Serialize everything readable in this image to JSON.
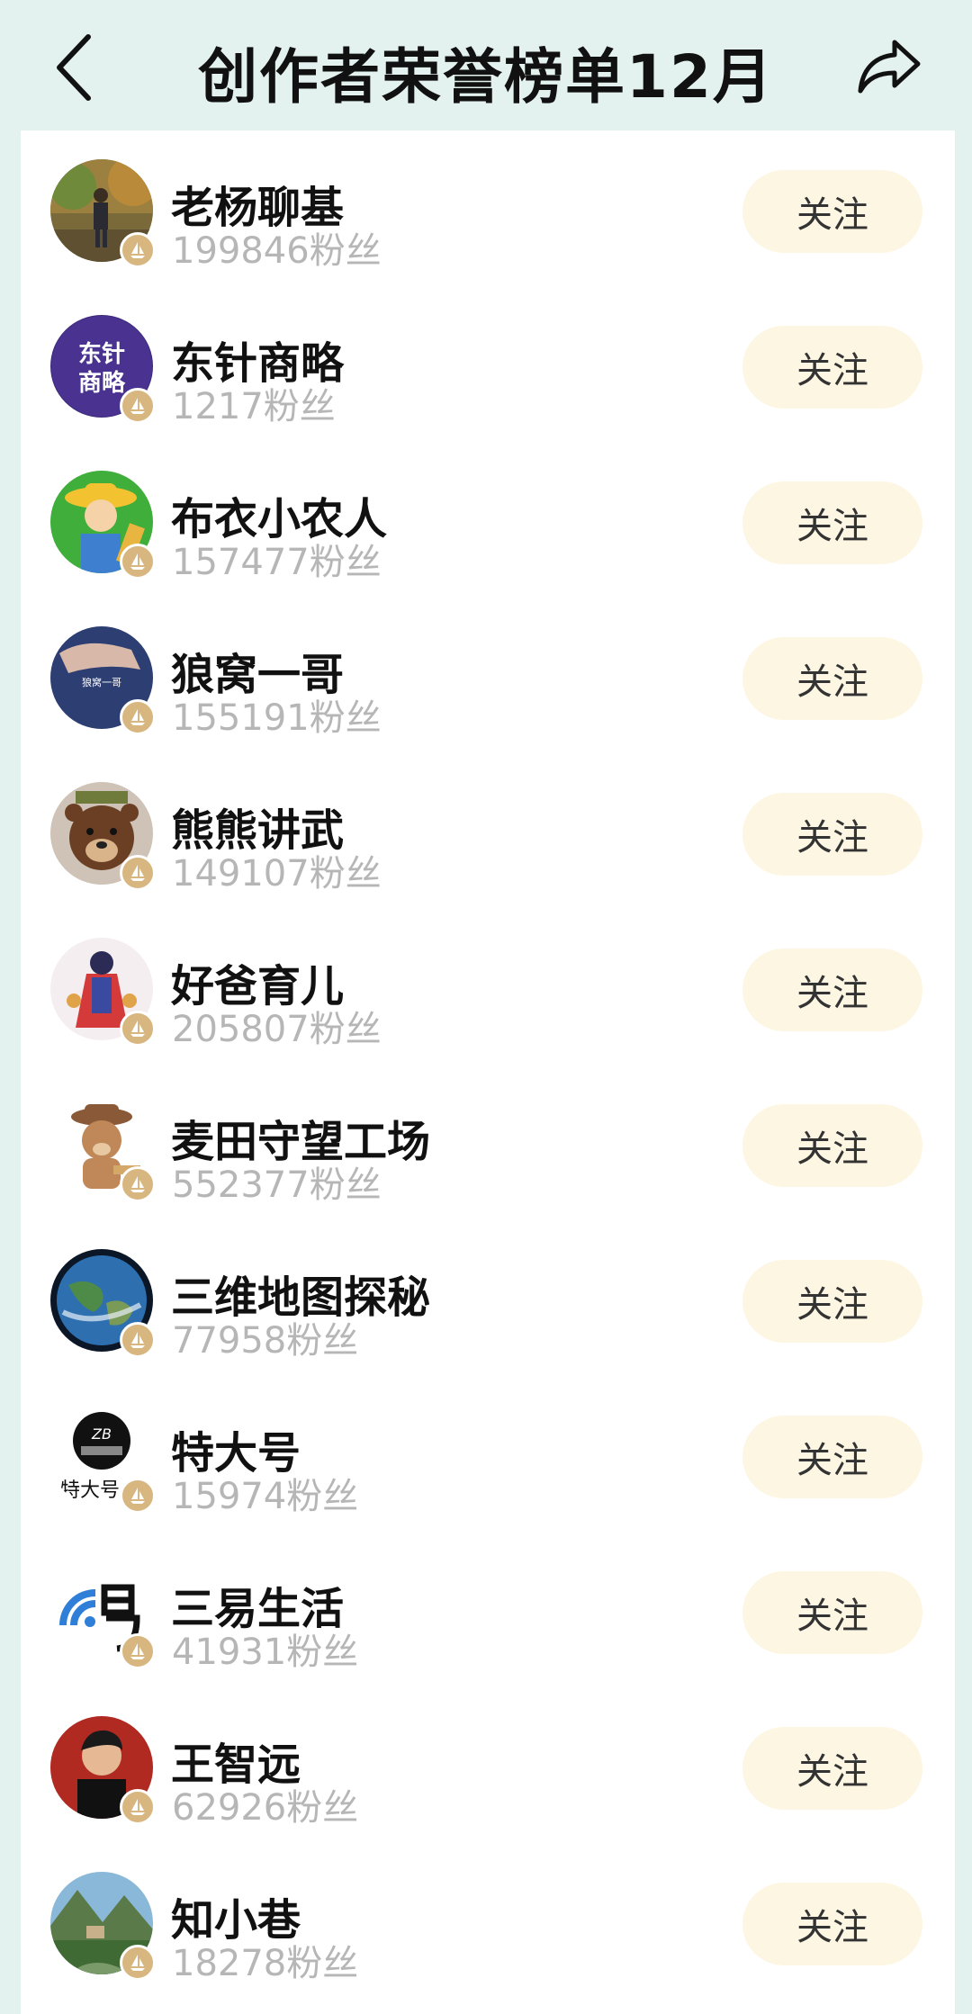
{
  "header": {
    "title": "创作者荣誉榜单12月"
  },
  "icons": {
    "back": "chevron-left-icon",
    "share": "share-arrow-icon",
    "badge": "creator-badge-icon"
  },
  "colors": {
    "background": "#e3f2ee",
    "follow_button": "#fdf6e3",
    "badge": "#d8b680",
    "fans_text": "#b6b6b6"
  },
  "creators": [
    {
      "name": "老杨聊基",
      "fans": "199846粉丝",
      "follow_label": "关注"
    },
    {
      "name": "东针商略",
      "fans": "1217粉丝",
      "follow_label": "关注"
    },
    {
      "name": "布衣小农人",
      "fans": "157477粉丝",
      "follow_label": "关注"
    },
    {
      "name": "狼窝一哥",
      "fans": "155191粉丝",
      "follow_label": "关注"
    },
    {
      "name": "熊熊讲武",
      "fans": "149107粉丝",
      "follow_label": "关注"
    },
    {
      "name": "好爸育儿",
      "fans": "205807粉丝",
      "follow_label": "关注"
    },
    {
      "name": "麦田守望工场",
      "fans": "552377粉丝",
      "follow_label": "关注"
    },
    {
      "name": "三维地图探秘",
      "fans": "77958粉丝",
      "follow_label": "关注"
    },
    {
      "name": "特大号",
      "fans": "15974粉丝",
      "follow_label": "关注"
    },
    {
      "name": "三易生活",
      "fans": "41931粉丝",
      "follow_label": "关注"
    },
    {
      "name": "王智远",
      "fans": "62926粉丝",
      "follow_label": "关注"
    },
    {
      "name": "知小巷",
      "fans": "18278粉丝",
      "follow_label": "关注"
    }
  ],
  "avatar_logo_text": {
    "dongzhen": [
      "东针",
      "商略"
    ],
    "langwo": "狼窝一哥",
    "tedahao_mark": "ZB",
    "tedahao_text": "特大号"
  }
}
